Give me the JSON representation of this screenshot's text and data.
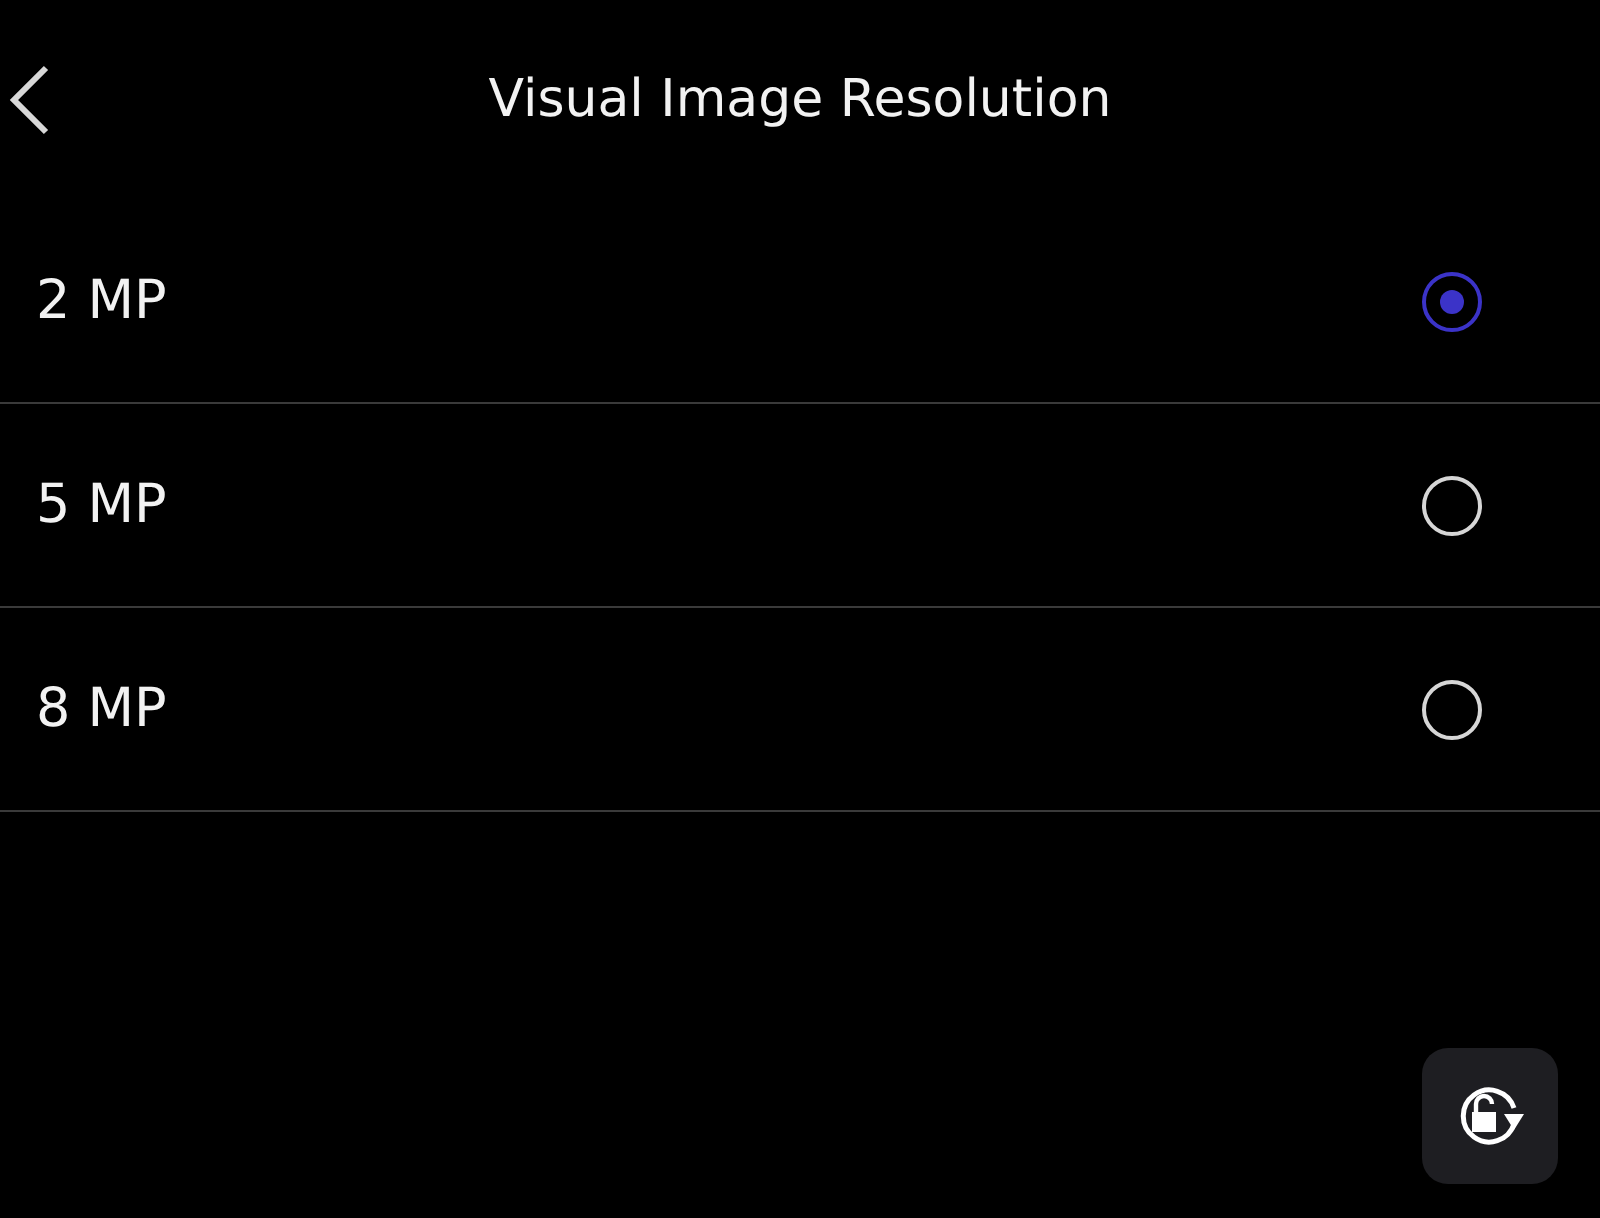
{
  "header": {
    "title": "Visual Image Resolution"
  },
  "options": [
    {
      "label": "2 MP",
      "selected": true
    },
    {
      "label": "5 MP",
      "selected": false
    },
    {
      "label": "8 MP",
      "selected": false
    }
  ]
}
